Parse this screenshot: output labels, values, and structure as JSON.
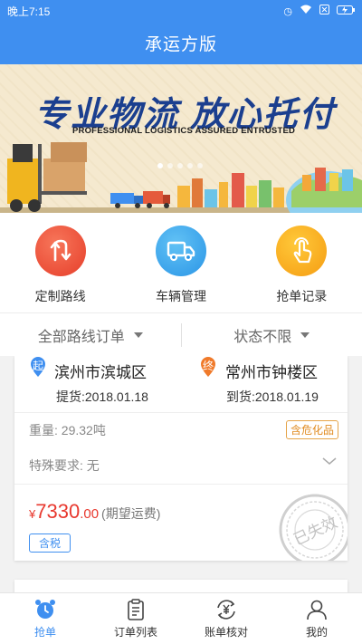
{
  "status_bar": {
    "time": "晚上7:15",
    "icons": [
      "alarm-icon",
      "wifi-icon",
      "sim-icon",
      "charging-icon"
    ]
  },
  "header": {
    "title": "承运方版"
  },
  "banner": {
    "headline": "专业物流  放心托付",
    "subline": "PROFESSIONAL LOGISTICS ASSURED ENTRUSTED"
  },
  "quick_actions": [
    {
      "label": "定制路线",
      "icon": "route-icon",
      "color": "#ef5a3c"
    },
    {
      "label": "车辆管理",
      "icon": "truck-icon",
      "color": "#3aa9ee"
    },
    {
      "label": "抢单记录",
      "icon": "tap-hand-icon",
      "color": "#f7a81c"
    }
  ],
  "filters": {
    "route": "全部路线订单",
    "status": "状态不限"
  },
  "order": {
    "origin_tag": "起",
    "origin_city": "滨州市滨城区",
    "pickup": "提货:2018.01.18",
    "dest_tag": "终",
    "dest_city": "常州市钟楼区",
    "delivery": "到货:2018.01.19",
    "weight": "重量: 29.32吨",
    "badge": "含危化品",
    "special": "特殊要求: 无",
    "currency": "¥",
    "price_int": "7330",
    "price_dec": ".00",
    "price_note": "(期望运费)",
    "tax": "含税",
    "stamp": "已失效"
  },
  "tabs": [
    {
      "label": "抢单",
      "icon": "alarm-clock-icon",
      "active": true
    },
    {
      "label": "订单列表",
      "icon": "clipboard-icon",
      "active": false
    },
    {
      "label": "账单核对",
      "icon": "yuan-refresh-icon",
      "active": false
    },
    {
      "label": "我的",
      "icon": "person-icon",
      "active": false
    }
  ],
  "colors": {
    "primary": "#3f8ff0",
    "price": "#e8382e",
    "warning": "#e08a1e"
  }
}
